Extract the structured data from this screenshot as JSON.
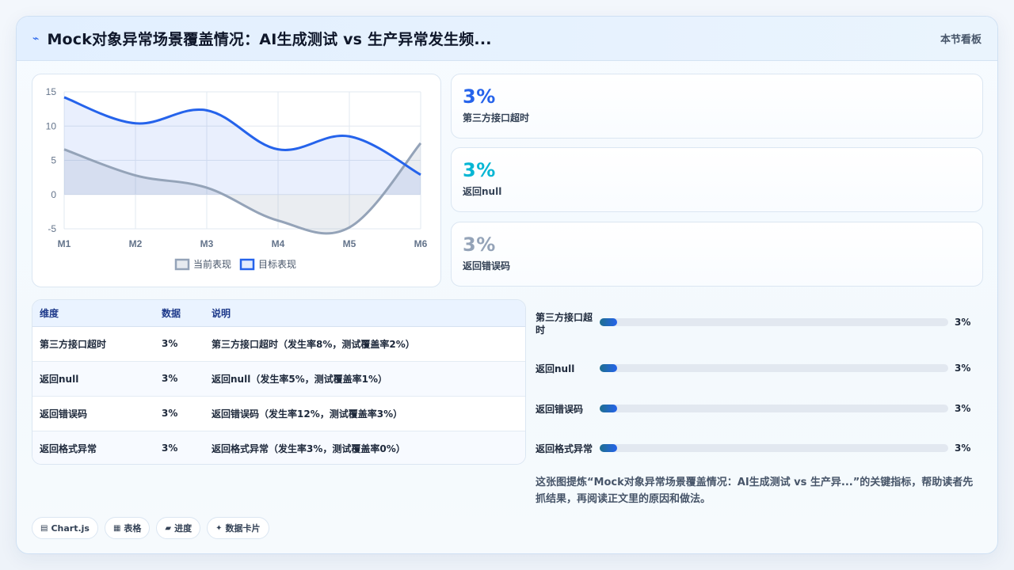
{
  "header": {
    "icon": "pulse-icon",
    "title": "Mock对象异常场景覆盖情况：AI生成测试 vs 生产异常发生频...",
    "right_label": "本节看板"
  },
  "chart_data": {
    "type": "area",
    "x": [
      "M1",
      "M2",
      "M3",
      "M4",
      "M5",
      "M6"
    ],
    "ylim": [
      -5,
      15
    ],
    "yticks": [
      -5,
      0,
      5,
      10,
      15
    ],
    "grid": true,
    "legend_position": "bottom",
    "series": [
      {
        "name": "当前表现",
        "values": [
          6.6,
          2.8,
          1.0,
          -3.8,
          -4.8,
          7.5
        ],
        "color": "#94a3b8"
      },
      {
        "name": "目标表现",
        "values": [
          14.2,
          10.4,
          12.3,
          6.6,
          8.5,
          2.9
        ],
        "color": "#2563eb"
      }
    ]
  },
  "kpis": [
    {
      "value": "3%",
      "label": "第三方接口超时",
      "color": "#2563eb"
    },
    {
      "value": "3%",
      "label": "返回null",
      "color": "#06b6d4"
    },
    {
      "value": "3%",
      "label": "返回错误码",
      "color": "#94a3b8"
    }
  ],
  "table": {
    "headers": [
      "维度",
      "数据",
      "说明"
    ],
    "rows": [
      [
        "第三方接口超时",
        "3%",
        "第三方接口超时（发生率8%，测试覆盖率2%）"
      ],
      [
        "返回null",
        "3%",
        "返回null（发生率5%，测试覆盖率1%）"
      ],
      [
        "返回错误码",
        "3%",
        "返回错误码（发生率12%，测试覆盖率3%）"
      ],
      [
        "返回格式异常",
        "3%",
        "返回格式异常（发生率3%，测试覆盖率0%）"
      ]
    ]
  },
  "progress": [
    {
      "label": "第三方接口超时",
      "value_text": "3%",
      "percent": 3
    },
    {
      "label": "返回null",
      "value_text": "3%",
      "percent": 3
    },
    {
      "label": "返回错误码",
      "value_text": "3%",
      "percent": 3
    },
    {
      "label": "返回格式异常",
      "value_text": "3%",
      "percent": 3
    }
  ],
  "note": "这张图提炼“Mock对象异常场景覆盖情况：AI生成测试 vs 生产异...”的关键指标，帮助读者先抓结果，再阅读正文里的原因和做法。",
  "chips": [
    {
      "icon": "chart-icon",
      "glyph": "▤",
      "label": "Chart.js"
    },
    {
      "icon": "table-icon",
      "glyph": "▦",
      "label": "表格"
    },
    {
      "icon": "progress-icon",
      "glyph": "▰",
      "label": "进度"
    },
    {
      "icon": "sparkle-icon",
      "glyph": "✦",
      "label": "数据卡片"
    }
  ]
}
